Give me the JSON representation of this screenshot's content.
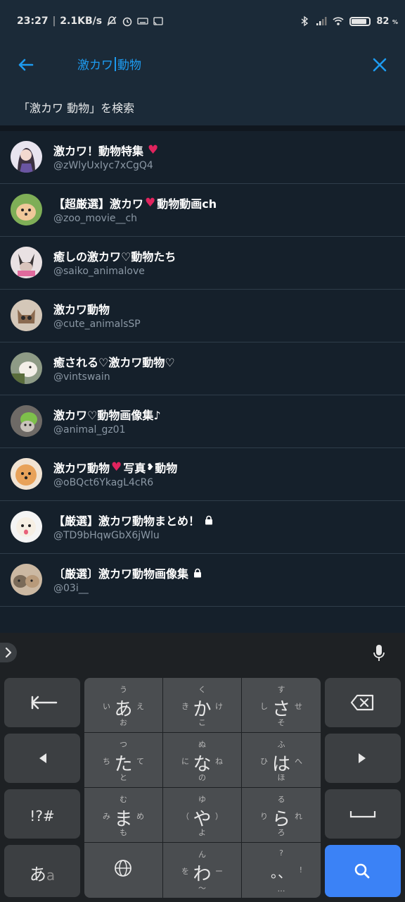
{
  "status": {
    "time": "23:27",
    "speed": "2.1KB/s",
    "battery": "82"
  },
  "search": {
    "query_before_caret": "激カワ",
    "query_after_caret": "動物",
    "suggestion": "「激カワ 動物」を検索"
  },
  "results": [
    {
      "name": "激カワ！動物特集",
      "handle": "@zWlyUxIyc7xCgQ4",
      "avatar": "anime-girl",
      "heart_after": true
    },
    {
      "name": "【超厳選】激カワ",
      "name2": "動物動画ch",
      "handle": "@zoo_movie__ch",
      "avatar": "puppy",
      "heart_mid": true
    },
    {
      "name": "癒しの激カワ♡動物たち",
      "handle": "@saiko_animalove",
      "avatar": "chihuahua"
    },
    {
      "name": "激カワ動物",
      "handle": "@cute_animalsSP",
      "avatar": "kitten"
    },
    {
      "name": "癒される♡激カワ動物♡",
      "handle": "@vintswain",
      "avatar": "hamster"
    },
    {
      "name": "激カワ♡動物画像集♪",
      "handle": "@animal_gz01",
      "avatar": "frog-cat"
    },
    {
      "name": "激カワ動物",
      "name2": "写真",
      "name3": "動物",
      "handle": "@oBQct6YkagL4cR6",
      "avatar": "pomeranian"
    },
    {
      "name": "【厳選】激カワ動物まとめ！",
      "handle": "@TD9bHqwGbX6jWlu",
      "avatar": "white-dog",
      "locked": true
    },
    {
      "name": "〔厳選〕激カワ動物画像集",
      "handle": "@03i__",
      "avatar": "cats",
      "locked": true
    }
  ],
  "keyboard": {
    "keys": {
      "a": {
        "main": "あ",
        "top": "う",
        "left": "い",
        "right": "え",
        "bottom": "お"
      },
      "ka": {
        "main": "か",
        "top": "く",
        "left": "き",
        "right": "け",
        "bottom": "こ"
      },
      "sa": {
        "main": "さ",
        "top": "す",
        "left": "し",
        "right": "せ",
        "bottom": "そ"
      },
      "ta": {
        "main": "た",
        "top": "つ",
        "left": "ち",
        "right": "て",
        "bottom": "と"
      },
      "na": {
        "main": "な",
        "top": "ぬ",
        "left": "に",
        "right": "ね",
        "bottom": "の"
      },
      "ha": {
        "main": "は",
        "top": "ふ",
        "left": "ひ",
        "right": "へ",
        "bottom": "ほ"
      },
      "ma": {
        "main": "ま",
        "top": "む",
        "left": "み",
        "right": "め",
        "bottom": "も"
      },
      "ya": {
        "main": "や",
        "top": "ゆ",
        "left": "（",
        "right": "）",
        "bottom": "よ"
      },
      "ra": {
        "main": "ら",
        "top": "る",
        "left": "り",
        "right": "れ",
        "bottom": "ろ"
      },
      "wa": {
        "main": "わ",
        "top": "ん",
        "left": "を",
        "right": "ー",
        "bottom": "～"
      },
      "punct": {
        "main": "。、",
        "top": "?",
        "right": "!",
        "bottom": "…"
      },
      "symbols": "!?#",
      "mode_main": "あ",
      "mode_sub": "a"
    }
  }
}
